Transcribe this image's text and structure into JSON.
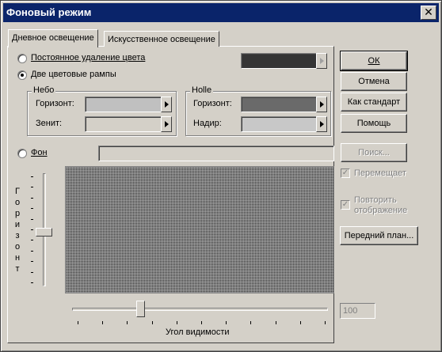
{
  "window": {
    "title": "Фоновый режим",
    "close_glyph": "✕"
  },
  "tabs": [
    {
      "label": "Дневное освещение",
      "active": true
    },
    {
      "label": "Искусственное освещение",
      "active": false
    }
  ],
  "options": {
    "solid_label": "Постоянное удаление цвета",
    "solid_selected": false,
    "solid_color": "#353535",
    "two_ramps_label": "Две цветовые рампы",
    "two_ramps_selected": true,
    "background_label": "Фон",
    "background_selected": false
  },
  "sky": {
    "group_title": "Небо",
    "horizon_label": "Горизонт:",
    "horizon_color": "#c0c0c0",
    "zenith_label": "Зенит:",
    "zenith_color": "#d4d0c8"
  },
  "ground": {
    "group_title": "Holle",
    "horizon_label": "Горизонт:",
    "horizon_color": "#6a6a6a",
    "nadir_label": "Надир:",
    "nadir_color": "#c8c8c8"
  },
  "buttons": {
    "ok": "ОК",
    "cancel": "Отмена",
    "default": "Как стандарт",
    "help": "Помощь",
    "browse": "Поиск...",
    "foreground": "Передний план..."
  },
  "checkboxes": {
    "moves_label": "Перемещает",
    "moves_checked": true,
    "repeat_label_1": "Повторить",
    "repeat_label_2": "отображение",
    "repeat_checked": true
  },
  "sliders": {
    "horizon_vertical_label": "Горизонт",
    "horizon_value_fraction": 0.52,
    "view_angle_label": "Угол видимости",
    "view_angle_value": "100",
    "view_angle_fraction": 0.26
  },
  "icons": {
    "arrow": "arrow-right-icon",
    "check": "check-icon"
  }
}
